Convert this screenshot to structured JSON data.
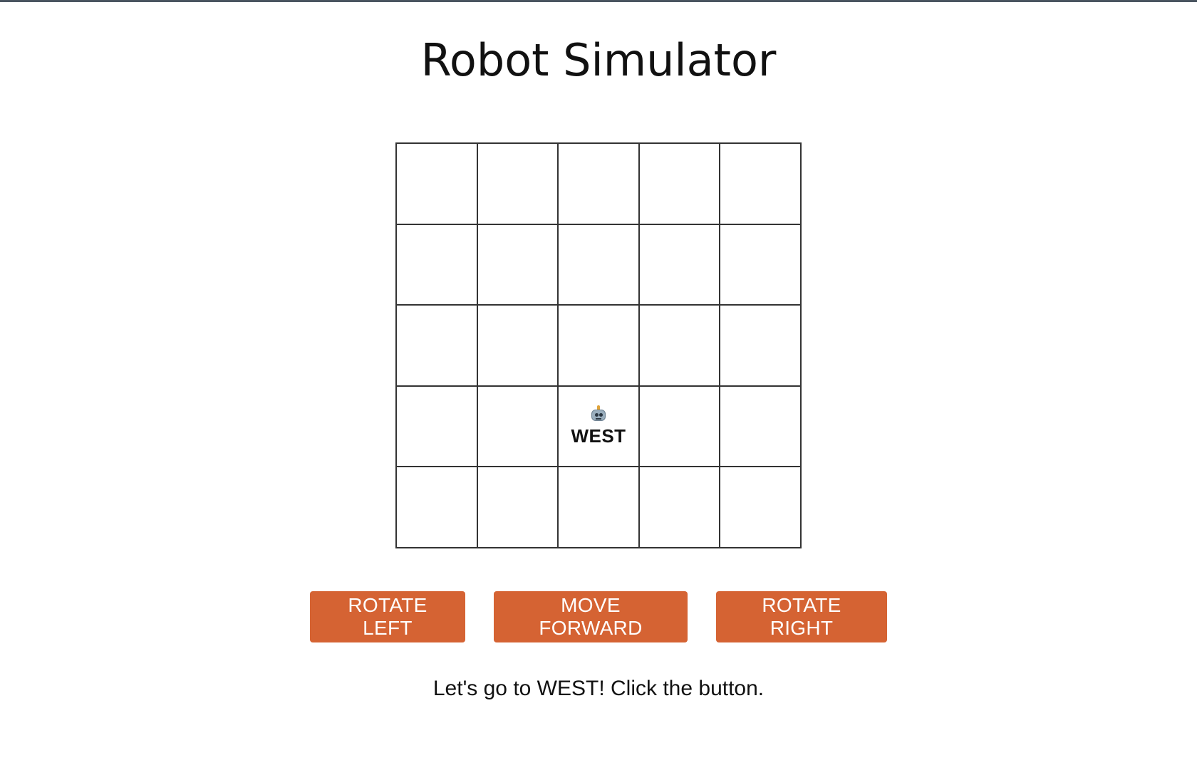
{
  "page": {
    "title": "Robot Simulator"
  },
  "grid": {
    "rows": 5,
    "cols": 5,
    "robot": {
      "row": 3,
      "col": 2,
      "icon": "robot-face-icon",
      "direction": "WEST"
    }
  },
  "controls": {
    "rotate_left": "ROTATE LEFT",
    "move_forward": "MOVE FORWARD",
    "rotate_right": "ROTATE RIGHT"
  },
  "status": {
    "message": "Let's go to WEST! Click the button."
  },
  "colors": {
    "button_bg": "#d56333",
    "button_text": "#ffffff",
    "grid_line": "#333333"
  }
}
